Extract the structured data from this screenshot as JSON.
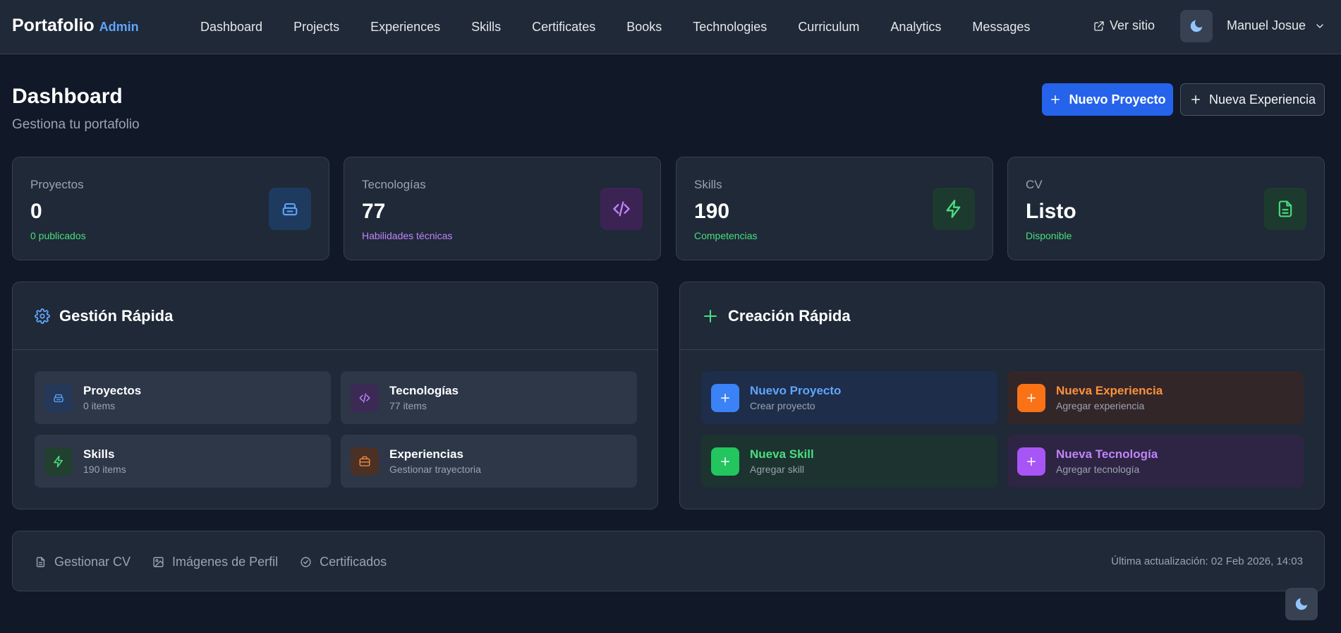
{
  "brand": {
    "name": "Portafolio",
    "badge": "Admin"
  },
  "nav": {
    "links": [
      "Dashboard",
      "Projects",
      "Experiences",
      "Skills",
      "Certificates",
      "Books",
      "Technologies",
      "Curriculum",
      "Analytics",
      "Messages"
    ],
    "view_site": "Ver sitio",
    "user": "Manuel Josue"
  },
  "header": {
    "title": "Dashboard",
    "subtitle": "Gestiona tu portafolio",
    "primary_action": "Nuevo Proyecto",
    "secondary_action": "Nueva Experiencia"
  },
  "stats": [
    {
      "label": "Proyectos",
      "value": "0",
      "sub": "0 publicados",
      "color": "#4ade80",
      "icon": "box-icon"
    },
    {
      "label": "Tecnologías",
      "value": "77",
      "sub": "Habilidades técnicas",
      "color": "#c084fc",
      "icon": "code-icon"
    },
    {
      "label": "Skills",
      "value": "190",
      "sub": "Competencias",
      "color": "#4ade80",
      "icon": "lightning-icon"
    },
    {
      "label": "CV",
      "value": "Listo",
      "sub": "Disponible",
      "color": "#4ade80",
      "icon": "document-icon"
    }
  ],
  "quick_manage": {
    "title": "Gestión Rápida",
    "items": [
      {
        "title": "Proyectos",
        "sub": "0 items",
        "icon": "box-icon"
      },
      {
        "title": "Tecnologías",
        "sub": "77 items",
        "icon": "code-icon"
      },
      {
        "title": "Skills",
        "sub": "190 items",
        "icon": "lightning-icon"
      },
      {
        "title": "Experiencias",
        "sub": "Gestionar trayectoria",
        "icon": "briefcase-icon"
      }
    ]
  },
  "quick_create": {
    "title": "Creación Rápida",
    "items": [
      {
        "title": "Nuevo Proyecto",
        "sub": "Crear proyecto",
        "color": "#60a5fa",
        "icon": "plus-icon"
      },
      {
        "title": "Nueva Experiencia",
        "sub": "Agregar experiencia",
        "color": "#fb923c",
        "icon": "plus-icon"
      },
      {
        "title": "Nueva Skill",
        "sub": "Agregar skill",
        "color": "#4ade80",
        "icon": "plus-icon"
      },
      {
        "title": "Nueva Tecnología",
        "sub": "Agregar tecnología",
        "color": "#c084fc",
        "icon": "plus-icon"
      }
    ]
  },
  "footer": {
    "links": [
      "Gestionar CV",
      "Imágenes de Perfil",
      "Certificados"
    ],
    "updated": "Última actualización: 02 Feb 2026, 14:03"
  },
  "colors": {
    "background": "#111827",
    "surface": "#1f2937",
    "accent": "#2563eb"
  }
}
